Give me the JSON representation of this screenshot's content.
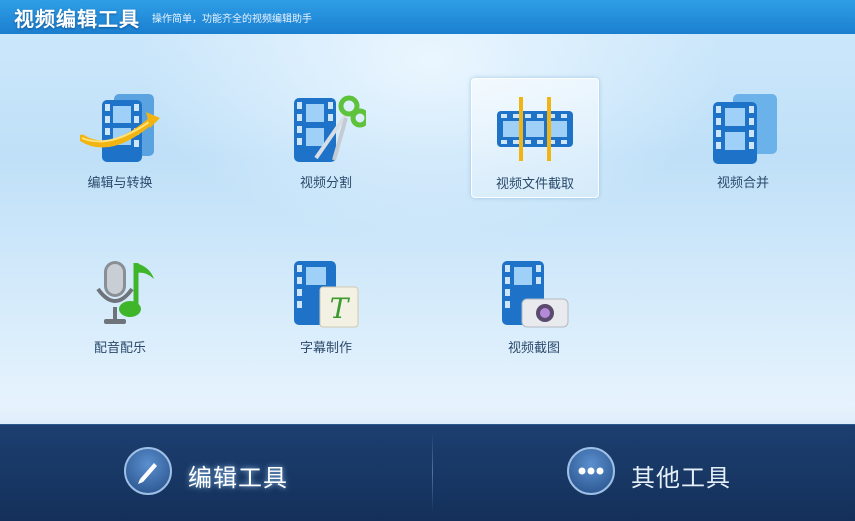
{
  "window": {
    "title": "视频编辑工具",
    "subtitle": "操作简单，功能齐全的视频编辑助手"
  },
  "tools": [
    {
      "label": "编辑与转换",
      "icon": "film-convert-icon"
    },
    {
      "label": "视频分割",
      "icon": "film-scissors-icon"
    },
    {
      "label": "视频文件截取",
      "icon": "film-trim-icon",
      "selected": true
    },
    {
      "label": "视频合并",
      "icon": "film-merge-icon"
    },
    {
      "label": "配音配乐",
      "icon": "microphone-music-icon"
    },
    {
      "label": "字幕制作",
      "icon": "film-subtitle-icon"
    },
    {
      "label": "视频截图",
      "icon": "film-camera-icon"
    }
  ],
  "bottom": {
    "edit_tools_label": "编辑工具",
    "other_tools_label": "其他工具",
    "active": "edit_tools"
  },
  "colors": {
    "title_bar": "#1b7fd0",
    "bottom_bar": "#1c3f70",
    "film_blue": "#1e73c8",
    "label_text": "#2b4a6b"
  }
}
